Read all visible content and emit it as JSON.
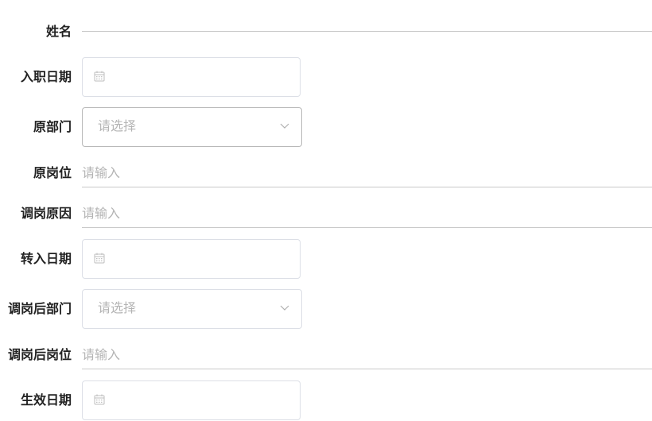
{
  "form": {
    "name": {
      "label": "姓名"
    },
    "entry_date": {
      "label": "入职日期",
      "icon": "calendar-icon"
    },
    "orig_dept": {
      "label": "原部门",
      "placeholder": "请选择",
      "icon": "chevron-down-icon"
    },
    "orig_post": {
      "label": "原岗位",
      "placeholder": "请输入"
    },
    "reason": {
      "label": "调岗原因",
      "placeholder": "请输入"
    },
    "transfer_date": {
      "label": "转入日期",
      "icon": "calendar-icon"
    },
    "new_dept": {
      "label": "调岗后部门",
      "placeholder": "请选择",
      "icon": "chevron-down-icon"
    },
    "new_post": {
      "label": "调岗后岗位",
      "placeholder": "请输入"
    },
    "effective_date": {
      "label": "生效日期",
      "icon": "calendar-icon"
    }
  }
}
